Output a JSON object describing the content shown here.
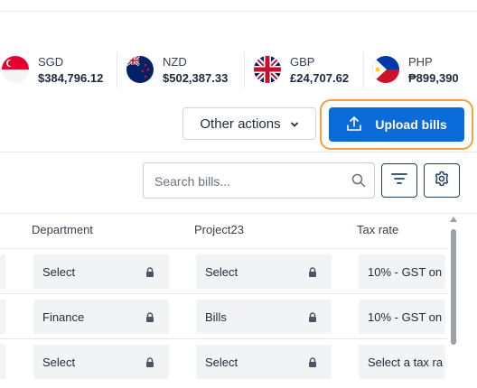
{
  "currencies": [
    {
      "code": "SGD",
      "amount": "$384,796.12",
      "flag": "sg-flag-icon"
    },
    {
      "code": "NZD",
      "amount": "$502,387.33",
      "flag": "nz-flag-icon"
    },
    {
      "code": "GBP",
      "amount": "£24,707.62",
      "flag": "gb-flag-icon"
    },
    {
      "code": "PHP",
      "amount": "₱899,390",
      "flag": "ph-flag-icon"
    }
  ],
  "actions": {
    "other_label": "Other actions",
    "upload_label": "Upload bills"
  },
  "search": {
    "placeholder": "Search bills..."
  },
  "table": {
    "headers": [
      "Department",
      "Project23",
      "Tax rate"
    ],
    "rows": [
      [
        "Select",
        "Select",
        "10% - GST on"
      ],
      [
        "Finance",
        "Bills",
        "10% - GST on"
      ],
      [
        "Select",
        "Select",
        "Select a tax ra"
      ]
    ]
  },
  "colors": {
    "primary": "#0b6bd8",
    "focus": "#f59e3b",
    "cell_bg": "#f1f3f5"
  }
}
